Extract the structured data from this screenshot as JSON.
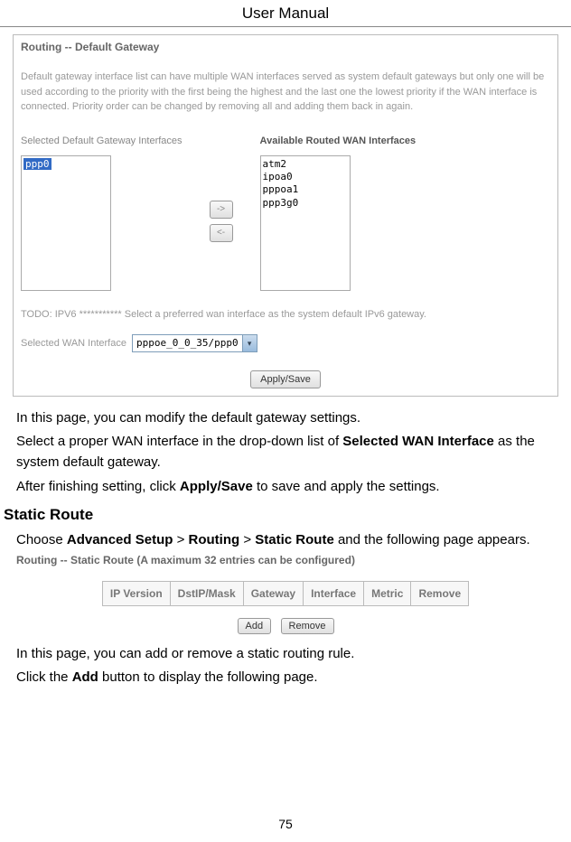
{
  "header": "User Manual",
  "screenshot1": {
    "title": "Routing -- Default Gateway",
    "description": "Default gateway interface list can have multiple WAN interfaces served as system default gateways but only one will be used according to the priority with the first being the highest and the last one the lowest priority if the WAN interface is connected. Priority order can be changed by removing all and adding them back in again.",
    "selected_label": "Selected Default Gateway Interfaces",
    "available_label": "Available Routed WAN Interfaces",
    "selected_item": "ppp0",
    "available_items": [
      "atm2",
      "ipoa0",
      "pppoa1",
      "ppp3g0"
    ],
    "arrow_right": "->",
    "arrow_left": "<-",
    "todo": "TODO: IPV6 *********** Select a preferred wan interface as the system default IPv6 gateway.",
    "wan_label": "Selected WAN Interface",
    "wan_value": "pppoe_0_0_35/ppp0",
    "apply_btn": "Apply/Save"
  },
  "body1": {
    "p1": "In this page, you can modify the default gateway settings.",
    "p2a": "Select a proper WAN interface in the drop-down list of ",
    "p2b": "Selected WAN Interface",
    "p2c": " as the system default gateway.",
    "p3a": "After finishing setting, click ",
    "p3b": "Apply/Save",
    "p3c": " to save and apply the settings."
  },
  "section_heading": "Static Route",
  "body2": {
    "p1a": "Choose ",
    "p1b": "Advanced Setup",
    "p1c": " > ",
    "p1d": "Routing",
    "p1e": " > ",
    "p1f": "Static Route",
    "p1g": " and the following page appears."
  },
  "screenshot2": {
    "title": "Routing -- Static Route (A maximum 32 entries can be configured)",
    "headers": [
      "IP Version",
      "DstIP/Mask",
      "Gateway",
      "Interface",
      "Metric",
      "Remove"
    ],
    "add_btn": "Add",
    "remove_btn": "Remove"
  },
  "body3": {
    "p1": "In this page, you can add or remove a static routing rule.",
    "p2a": "Click the ",
    "p2b": "Add",
    "p2c": " button to display the following page."
  },
  "page_number": "75"
}
